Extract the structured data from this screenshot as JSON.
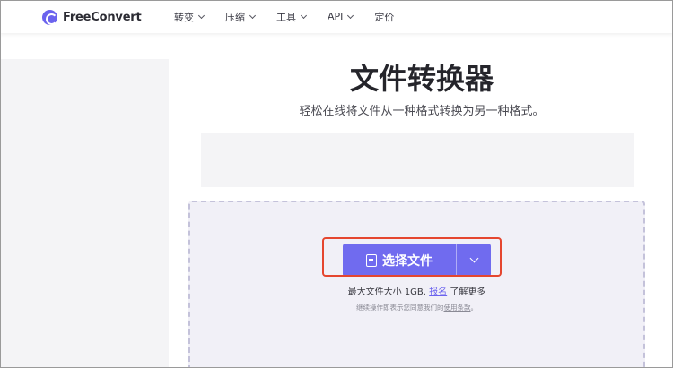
{
  "header": {
    "logo_text": "FreeConvert",
    "nav": [
      {
        "label": "转变",
        "has_dropdown": true
      },
      {
        "label": "压缩",
        "has_dropdown": true
      },
      {
        "label": "工具",
        "has_dropdown": true
      },
      {
        "label": "API",
        "has_dropdown": true
      },
      {
        "label": "定价",
        "has_dropdown": false
      }
    ]
  },
  "main": {
    "title": "文件转换器",
    "subtitle": "轻松在线将文件从一种格式转换为另一种格式。",
    "choose_button_label": "选择文件",
    "max_size_prefix": "最大文件大小 1GB.",
    "max_size_link": "报名",
    "max_size_suffix": " 了解更多",
    "terms_prefix": "继续操作即表示您同意我们的",
    "terms_link": "使用条款",
    "terms_suffix": "。"
  },
  "colors": {
    "accent": "#706bef",
    "highlight": "#e5462f",
    "dropzone_bg": "#f1f0f7"
  }
}
